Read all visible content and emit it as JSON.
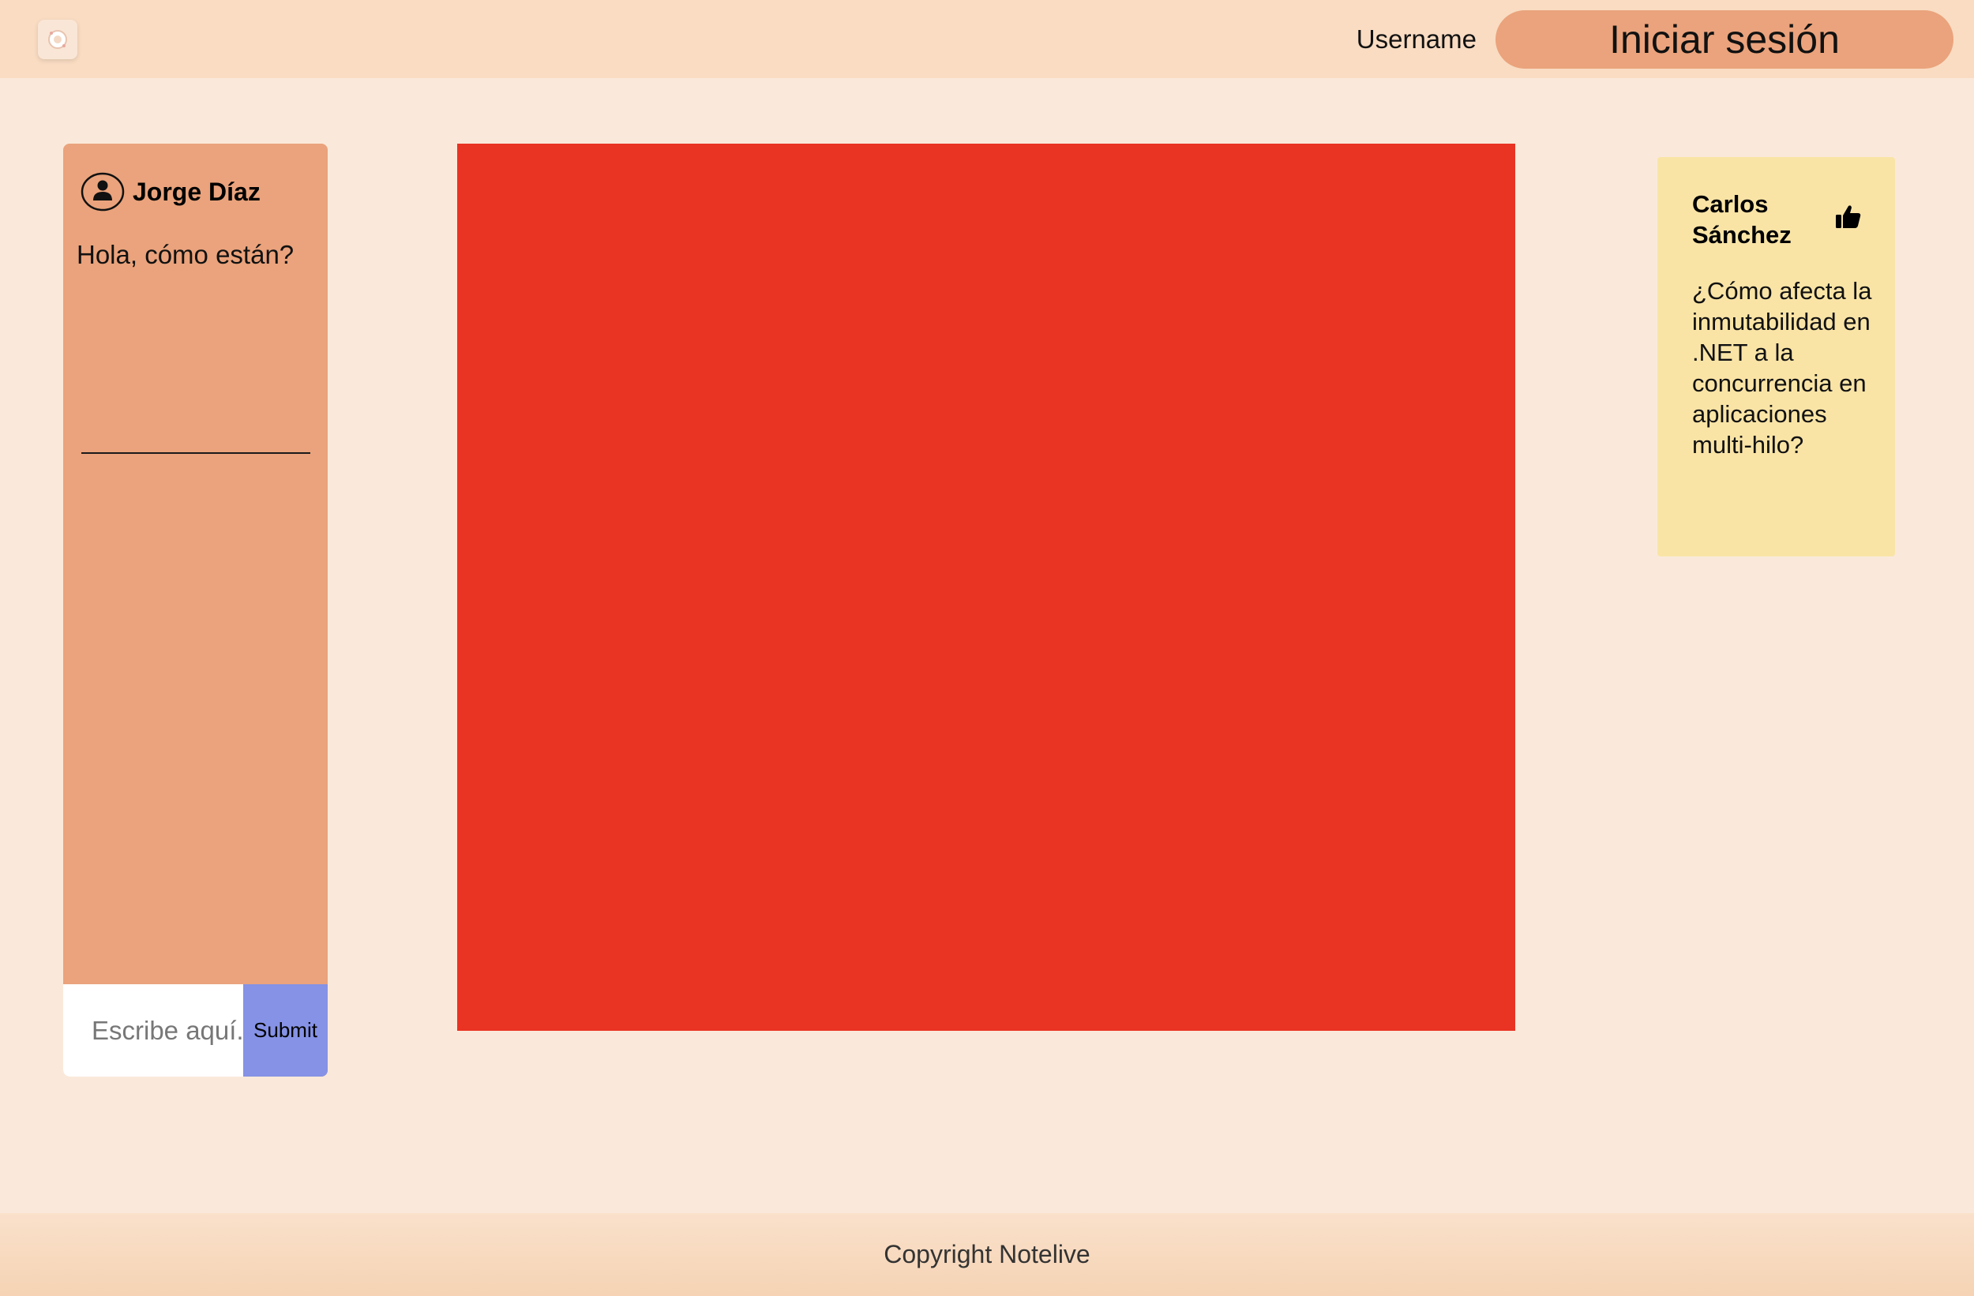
{
  "header": {
    "logo_icon": "app-logo-icon",
    "username_label": "Username",
    "login_button_label": "Iniciar sesión"
  },
  "chat": {
    "user_name": "Jorge Díaz",
    "user_icon": "user-avatar-icon",
    "messages": [
      {
        "text": "Hola, cómo están?"
      }
    ],
    "input_placeholder": "Escribe aquí...",
    "submit_label": "Submit"
  },
  "canvas": {
    "color": "#e93323"
  },
  "note": {
    "author": "Carlos Sánchez",
    "like_icon": "thumbs-up-icon",
    "text": "¿Cómo afecta la inmutabilidad en .NET a la concurrencia en aplicaciones multi-hilo?"
  },
  "footer": {
    "text": "Copyright Notelive"
  },
  "colors": {
    "header_bg": "#f9dcc2",
    "page_bg": "#fae9da",
    "accent": "#eaa37c",
    "submit_bg": "#8592e5",
    "note_bg": "#f9e4a6"
  }
}
